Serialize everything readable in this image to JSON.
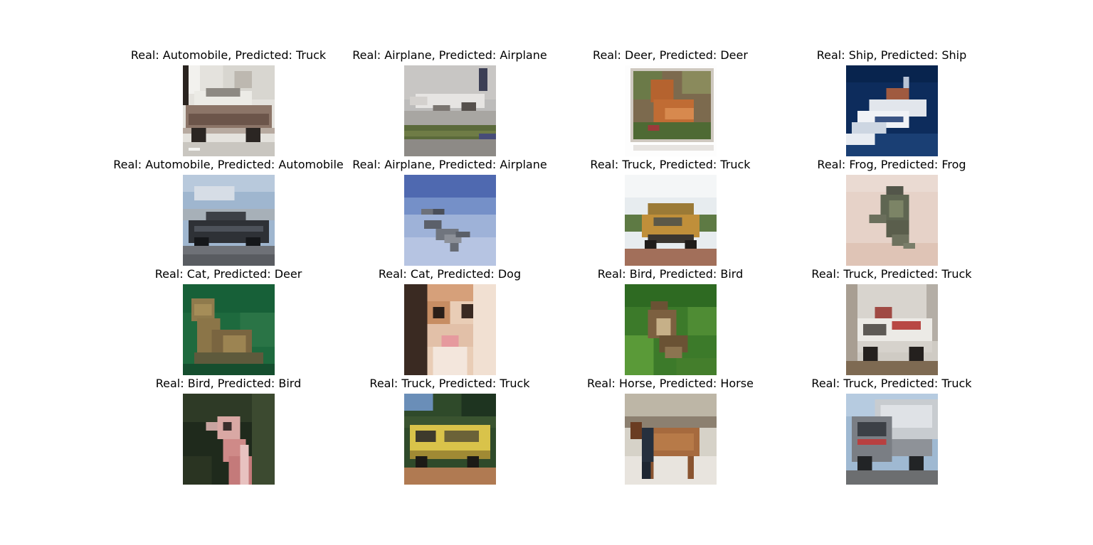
{
  "panels": [
    {
      "title": "Real: Automobile, Predicted: Truck",
      "scene": "car-white"
    },
    {
      "title": "Real: Airplane, Predicted: Airplane",
      "scene": "airplane-runway"
    },
    {
      "title": "Real: Deer, Predicted: Deer",
      "scene": "deer-photo"
    },
    {
      "title": "Real: Ship, Predicted: Ship",
      "scene": "speedboat"
    },
    {
      "title": "Real: Automobile, Predicted: Automobile",
      "scene": "car-dark"
    },
    {
      "title": "Real: Airplane, Predicted: Airplane",
      "scene": "jet-sky"
    },
    {
      "title": "Real: Truck, Predicted: Truck",
      "scene": "dump-truck"
    },
    {
      "title": "Real: Frog, Predicted: Frog",
      "scene": "frog"
    },
    {
      "title": "Real: Cat, Predicted: Deer",
      "scene": "cat-green"
    },
    {
      "title": "Real: Cat, Predicted: Dog",
      "scene": "cat-closeup"
    },
    {
      "title": "Real: Bird, Predicted: Bird",
      "scene": "bird-grass"
    },
    {
      "title": "Real: Truck, Predicted: Truck",
      "scene": "fire-truck-white"
    },
    {
      "title": "Real: Bird, Predicted: Bird",
      "scene": "ostrich"
    },
    {
      "title": "Real: Truck, Predicted: Truck",
      "scene": "yellow-truck"
    },
    {
      "title": "Real: Horse, Predicted: Horse",
      "scene": "horse-person"
    },
    {
      "title": "Real: Truck, Predicted: Truck",
      "scene": "tanker-truck"
    }
  ]
}
